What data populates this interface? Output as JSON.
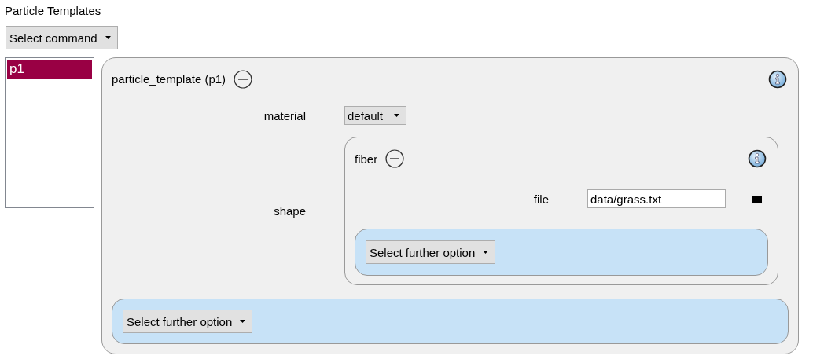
{
  "title": "Particle Templates",
  "command_select": {
    "value": "Select command"
  },
  "templates_list": [
    {
      "label": "p1",
      "selected": true
    }
  ],
  "template_panel": {
    "title": "particle_template (p1)",
    "fields": [
      {
        "kind": "select",
        "label": "material",
        "value": "default"
      },
      {
        "kind": "group",
        "label": "shape",
        "group": {
          "title": "fiber",
          "fields": [
            {
              "kind": "file",
              "label": "file",
              "value": "data/grass.txt"
            }
          ],
          "further_option": "Select further option"
        }
      }
    ],
    "further_option": "Select further option"
  }
}
